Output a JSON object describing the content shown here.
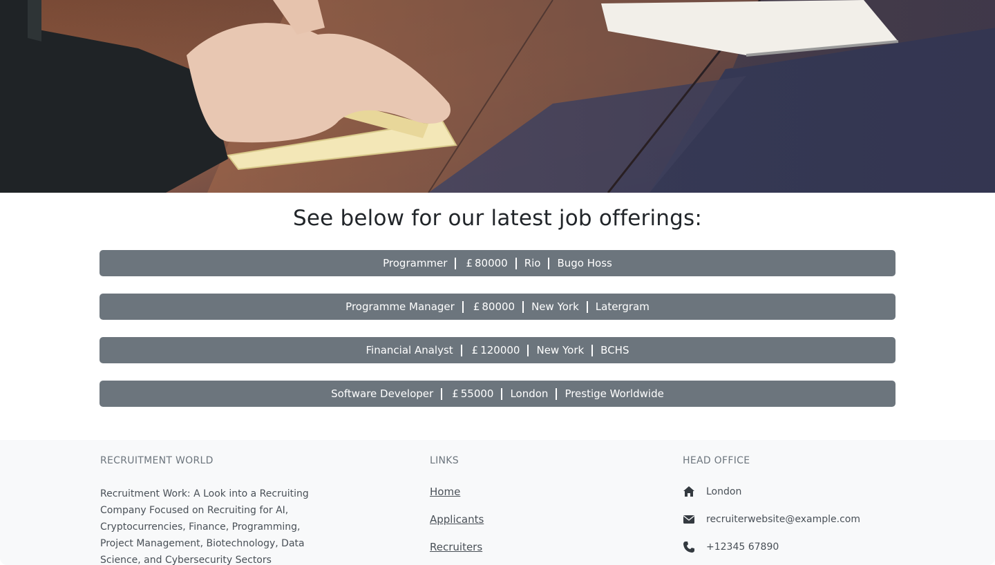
{
  "heading": "See below for our latest job offerings:",
  "currency_symbol": "£",
  "jobs": [
    {
      "title": "Programmer",
      "salary": "80000",
      "location": "Rio",
      "company": "Bugo Hoss"
    },
    {
      "title": "Programme Manager",
      "salary": "80000",
      "location": "New York",
      "company": "Latergram"
    },
    {
      "title": "Financial Analyst",
      "salary": "120000",
      "location": "New York",
      "company": "BCHS"
    },
    {
      "title": "Software Developer",
      "salary": "55000",
      "location": "London",
      "company": "Prestige Worldwide"
    }
  ],
  "footer": {
    "brand": {
      "title": "RECRUITMENT WORLD",
      "description": "Recruitment Work: A Look into a Recruiting Company Focused on Recruiting for AI, Cryptocurrencies, Finance, Programming, Project Management, Biotechnology, Data Science, and Cybersecurity Sectors"
    },
    "links": {
      "title": "LINKS",
      "items": [
        "Home",
        "Applicants",
        "Recruiters"
      ]
    },
    "office": {
      "title": "HEAD OFFICE",
      "address": "London",
      "email": "recruiterwebsite@example.com",
      "phone": "+12345 67890"
    }
  },
  "colors": {
    "job_bar": "#6c757d",
    "footer_bg": "#f8f9fa",
    "text_dark": "#212529",
    "text_muted": "#6c757d"
  },
  "icons": [
    "home-icon",
    "envelope-icon",
    "phone-icon"
  ]
}
